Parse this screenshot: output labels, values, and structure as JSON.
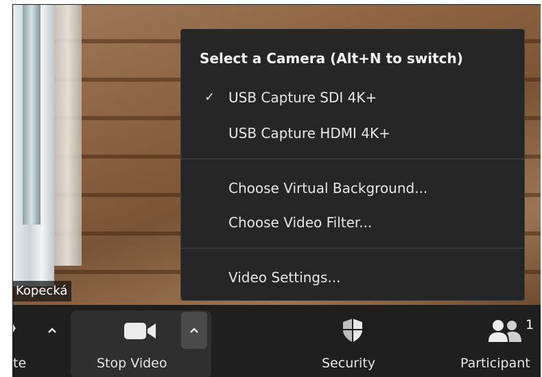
{
  "participant": {
    "name": "Kopecká"
  },
  "menu": {
    "title": "Select a Camera (Alt+N to switch)",
    "check_glyph": "✓",
    "cameras": [
      {
        "label": "USB Capture SDI 4K+",
        "selected": true
      },
      {
        "label": "USB Capture HDMI 4K+",
        "selected": false
      }
    ],
    "options": [
      {
        "label": "Choose Virtual Background..."
      },
      {
        "label": "Choose Video Filter..."
      }
    ],
    "settings": {
      "label": "Video Settings..."
    }
  },
  "toolbar": {
    "mute": {
      "label": "te"
    },
    "video": {
      "label": "Stop Video"
    },
    "security": {
      "label": "Security"
    },
    "participants": {
      "label": "Participant",
      "count": "1"
    }
  },
  "colors": {
    "menu_bg": "#262626",
    "toolbar_bg": "#1f1f1f",
    "active_button_bg": "#2f2f2f"
  }
}
